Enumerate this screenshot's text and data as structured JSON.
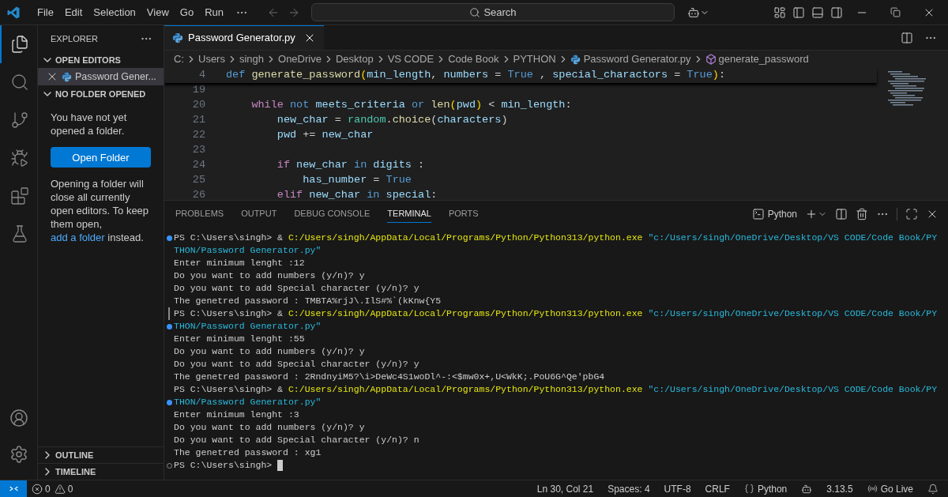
{
  "menu": [
    "File",
    "Edit",
    "Selection",
    "View",
    "Go",
    "Run"
  ],
  "command_center": {
    "label": "Search"
  },
  "activity_bar": [
    {
      "kind": "files",
      "selected": true
    },
    {
      "kind": "search",
      "selected": false
    },
    {
      "kind": "source-control",
      "selected": false
    },
    {
      "kind": "run",
      "selected": false
    },
    {
      "kind": "extensions",
      "selected": false
    },
    {
      "kind": "testing",
      "selected": false
    }
  ],
  "sidebar": {
    "title": "EXPLORER",
    "open_editors": {
      "title": "OPEN EDITORS",
      "expanded": true,
      "items": [
        {
          "label": "Password Gener...",
          "selected": true
        }
      ]
    },
    "no_folder": {
      "title": "NO FOLDER OPENED",
      "expanded": true,
      "message": "You have not yet opened a folder.",
      "button": "Open Folder",
      "note_before": "Opening a folder will close all currently open editors. To keep them open,",
      "note_link": "add a folder",
      "note_after": "instead."
    },
    "sections": [
      {
        "title": "OUTLINE",
        "expanded": false
      },
      {
        "title": "TIMELINE",
        "expanded": false
      }
    ]
  },
  "tabs": [
    {
      "label": "Password Generator.py",
      "selected": true
    }
  ],
  "breadcrumbs": [
    {
      "text": "C:",
      "kind": "folder"
    },
    {
      "text": "Users",
      "kind": "folder"
    },
    {
      "text": "singh",
      "kind": "folder"
    },
    {
      "text": "OneDrive",
      "kind": "folder"
    },
    {
      "text": "Desktop",
      "kind": "folder"
    },
    {
      "text": "VS CODE",
      "kind": "folder"
    },
    {
      "text": "Code Book",
      "kind": "folder"
    },
    {
      "text": "PYTHON",
      "kind": "folder"
    },
    {
      "text": "Password Generator.py",
      "kind": "file"
    },
    {
      "text": "generate_password",
      "kind": "symbol"
    }
  ],
  "code": [
    {
      "number": "4",
      "sticky": true,
      "tokens": [
        {
          "text": "def",
          "kind": "keyword"
        },
        {
          "text": " generate_password",
          "kind": "function"
        },
        {
          "text": "(",
          "kind": "bracket"
        },
        {
          "text": "min_length",
          "kind": "variable"
        },
        {
          "text": ", ",
          "kind": "plain"
        },
        {
          "text": "numbers",
          "kind": "variable"
        },
        {
          "text": " = ",
          "kind": "plain"
        },
        {
          "text": "True",
          "kind": "constant"
        },
        {
          "text": " , ",
          "kind": "plain"
        },
        {
          "text": "special_charactors",
          "kind": "variable"
        },
        {
          "text": " = ",
          "kind": "plain"
        },
        {
          "text": "True",
          "kind": "constant"
        },
        {
          "text": ")",
          "kind": "bracket"
        },
        {
          "text": ":",
          "kind": "plain"
        }
      ]
    },
    {
      "number": "19",
      "sticky": false
    },
    {
      "number": "20",
      "sticky": false,
      "tokens": [
        {
          "text": "    while",
          "kind": "control"
        },
        {
          "text": " not",
          "kind": "keyword"
        },
        {
          "text": " meets_criteria",
          "kind": "variable"
        },
        {
          "text": " or",
          "kind": "keyword"
        },
        {
          "text": " len",
          "kind": "function"
        },
        {
          "text": "(",
          "kind": "bracket"
        },
        {
          "text": "pwd",
          "kind": "variable"
        },
        {
          "text": ")",
          "kind": "bracket"
        },
        {
          "text": " < ",
          "kind": "plain"
        },
        {
          "text": "min_length",
          "kind": "variable"
        },
        {
          "text": ":",
          "kind": "plain"
        }
      ]
    },
    {
      "number": "21",
      "sticky": false,
      "tokens": [
        {
          "text": "        new_char",
          "kind": "variable"
        },
        {
          "text": " = ",
          "kind": "plain"
        },
        {
          "text": "random",
          "kind": "module"
        },
        {
          "text": ".",
          "kind": "plain"
        },
        {
          "text": "choice",
          "kind": "function"
        },
        {
          "text": "(",
          "kind": "plain"
        },
        {
          "text": "characters",
          "kind": "variable"
        },
        {
          "text": ")",
          "kind": "plain"
        }
      ]
    },
    {
      "number": "22",
      "sticky": false,
      "tokens": [
        {
          "text": "        pwd",
          "kind": "variable"
        },
        {
          "text": " += ",
          "kind": "plain"
        },
        {
          "text": "new_char",
          "kind": "variable"
        }
      ]
    },
    {
      "number": "23",
      "sticky": false
    },
    {
      "number": "24",
      "sticky": false,
      "tokens": [
        {
          "text": "        if",
          "kind": "control"
        },
        {
          "text": " new_char",
          "kind": "variable"
        },
        {
          "text": " in",
          "kind": "keyword"
        },
        {
          "text": " digits",
          "kind": "variable"
        },
        {
          "text": " :",
          "kind": "plain"
        }
      ]
    },
    {
      "number": "25",
      "sticky": false,
      "tokens": [
        {
          "text": "            has_number",
          "kind": "variable"
        },
        {
          "text": " = ",
          "kind": "plain"
        },
        {
          "text": "True",
          "kind": "constant"
        }
      ]
    },
    {
      "number": "26",
      "sticky": false,
      "tokens": [
        {
          "text": "        elif",
          "kind": "control"
        },
        {
          "text": " new_char",
          "kind": "variable"
        },
        {
          "text": " in",
          "kind": "keyword"
        },
        {
          "text": " special",
          "kind": "variable"
        },
        {
          "text": ":",
          "kind": "plain"
        }
      ]
    }
  ],
  "panel": {
    "tabs": [
      {
        "label": "PROBLEMS",
        "selected": false
      },
      {
        "label": "OUTPUT",
        "selected": false
      },
      {
        "label": "DEBUG CONSOLE",
        "selected": false
      },
      {
        "label": "TERMINAL",
        "selected": true
      },
      {
        "label": "PORTS",
        "selected": false
      }
    ],
    "terminal_name": "Python"
  },
  "terminal": [
    {
      "kind": "success",
      "segments": [
        {
          "text": "PS C:\\Users\\singh> & ",
          "kind": "plain"
        },
        {
          "text": "C:/Users/singh/AppData/Local/Programs/Python/Python313/python.exe",
          "kind": "path"
        },
        {
          "text": " \"c:/Users/singh/OneDrive/Desktop/VS CODE/Code Book/PY",
          "kind": "string"
        }
      ]
    },
    {
      "kind": "plain",
      "segments": [
        {
          "text": "THON/Password Generator.py\"",
          "kind": "string"
        }
      ]
    },
    {
      "kind": "plain",
      "segments": [
        {
          "text": "Enter minimum lenght :12",
          "kind": "plain"
        }
      ]
    },
    {
      "kind": "plain",
      "segments": [
        {
          "text": "Do you want to add numbers (y/n)? y",
          "kind": "plain"
        }
      ]
    },
    {
      "kind": "plain",
      "segments": [
        {
          "text": "Do you want to add Special character (y/n)? y",
          "kind": "plain"
        }
      ]
    },
    {
      "kind": "plain",
      "segments": [
        {
          "text": "The genetred password : TMBTA%rjJ\\.IlS#%`(kKnw{Y5",
          "kind": "plain"
        }
      ]
    },
    {
      "kind": "bar",
      "segments": [
        {
          "text": "PS C:\\Users\\singh> & ",
          "kind": "plain"
        },
        {
          "text": "C:/Users/singh/AppData/Local/Programs/Python/Python313/python.exe",
          "kind": "path"
        },
        {
          "text": " \"c:/Users/singh/OneDrive/Desktop/VS CODE/Code Book/PY",
          "kind": "string"
        }
      ]
    },
    {
      "kind": "success",
      "segments": [
        {
          "text": "THON/Password Generator.py\"",
          "kind": "string"
        }
      ]
    },
    {
      "kind": "plain",
      "segments": [
        {
          "text": "Enter minimum lenght :55",
          "kind": "plain"
        }
      ]
    },
    {
      "kind": "plain",
      "segments": [
        {
          "text": "Do you want to add numbers (y/n)? y",
          "kind": "plain"
        }
      ]
    },
    {
      "kind": "plain",
      "segments": [
        {
          "text": "Do you want to add Special character (y/n)? y",
          "kind": "plain"
        }
      ]
    },
    {
      "kind": "plain",
      "segments": [
        {
          "text": "The genetred password : 2RndnyiM5?\\i>DeWc4S1woDl^-:<$mw0x+,U<WkK;.PoU6G^Qe'pbG4",
          "kind": "plain"
        }
      ]
    },
    {
      "kind": "plain",
      "segments": [
        {
          "text": "PS C:\\Users\\singh> & ",
          "kind": "plain"
        },
        {
          "text": "C:/Users/singh/AppData/Local/Programs/Python/Python313/python.exe",
          "kind": "path"
        },
        {
          "text": " \"c:/Users/singh/OneDrive/Desktop/VS CODE/Code Book/PY",
          "kind": "string"
        }
      ]
    },
    {
      "kind": "success",
      "segments": [
        {
          "text": "THON/Password Generator.py\"",
          "kind": "string"
        }
      ]
    },
    {
      "kind": "plain",
      "segments": [
        {
          "text": "Enter minimum lenght :3",
          "kind": "plain"
        }
      ]
    },
    {
      "kind": "plain",
      "segments": [
        {
          "text": "Do you want to add numbers (y/n)? y",
          "kind": "plain"
        }
      ]
    },
    {
      "kind": "plain",
      "segments": [
        {
          "text": "Do you want to add Special character (y/n)? n",
          "kind": "plain"
        }
      ]
    },
    {
      "kind": "plain",
      "segments": [
        {
          "text": "The genetred password : xg1",
          "kind": "plain"
        }
      ]
    },
    {
      "kind": "pending",
      "cursor": true,
      "segments": [
        {
          "text": "PS C:\\Users\\singh>",
          "kind": "plain"
        }
      ]
    }
  ],
  "status_bar": {
    "errors": "0",
    "warnings": "0",
    "position": "Ln 30, Col 21",
    "indent": "Spaces: 4",
    "encoding": "UTF-8",
    "eol": "CRLF",
    "language": "Python",
    "python_version": "3.13.5",
    "live": "Go Live"
  }
}
